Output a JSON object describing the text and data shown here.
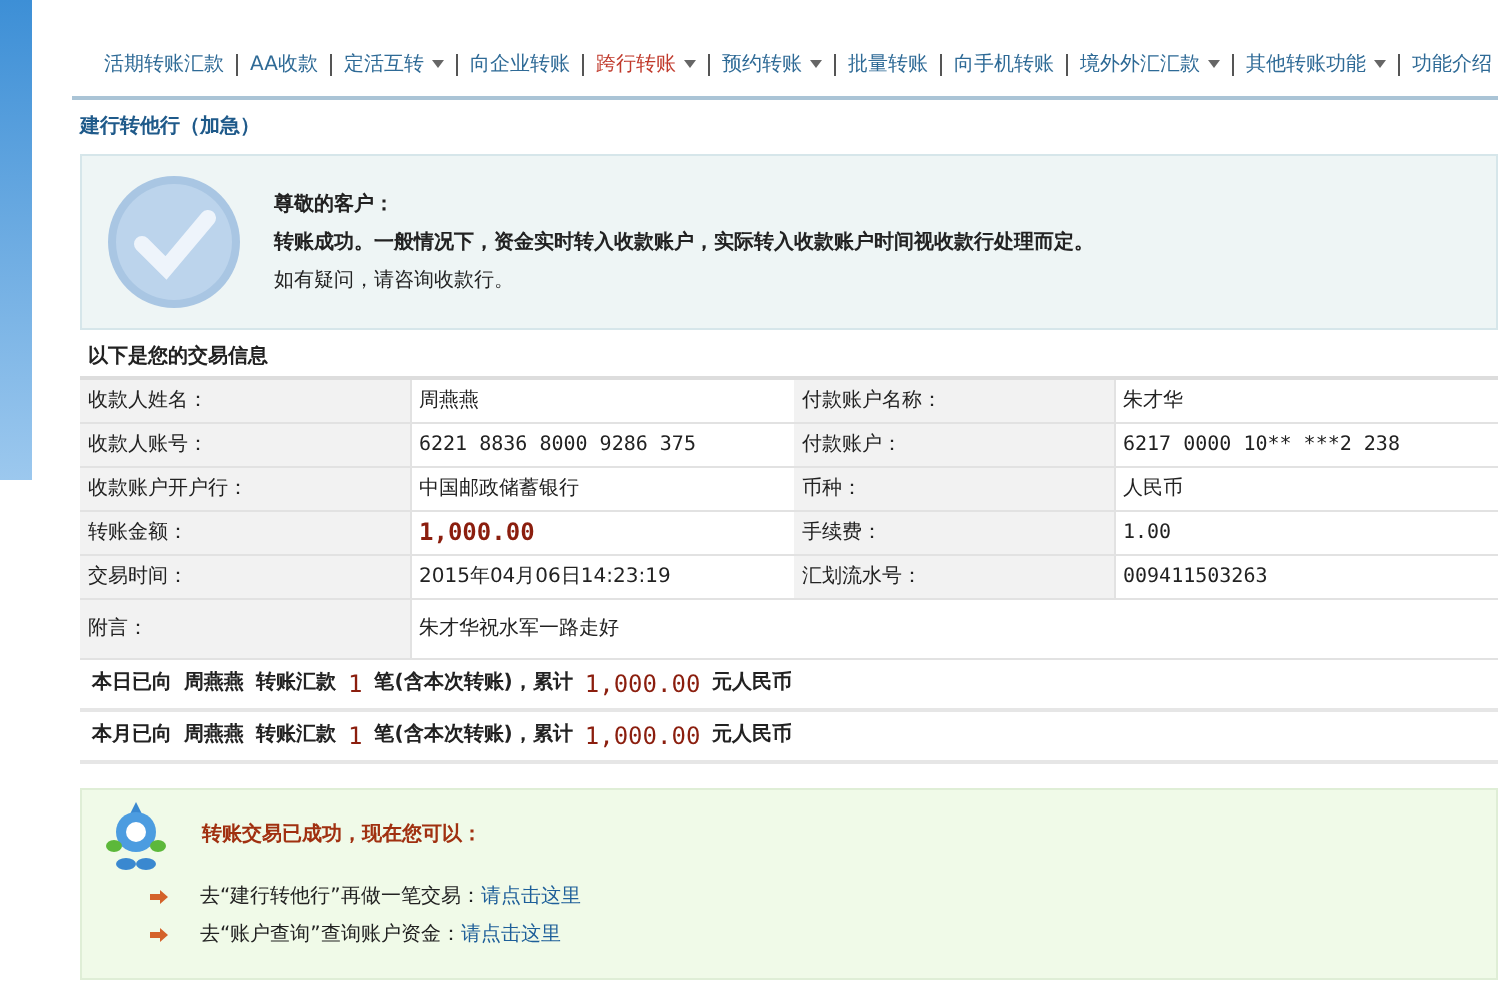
{
  "nav": [
    {
      "label": "活期转账汇款",
      "dropdown": false,
      "selected": false
    },
    {
      "label": "AA收款",
      "dropdown": false,
      "selected": false
    },
    {
      "label": "定活互转",
      "dropdown": true,
      "selected": false
    },
    {
      "label": "向企业转账",
      "dropdown": false,
      "selected": false
    },
    {
      "label": "跨行转账",
      "dropdown": true,
      "selected": true
    },
    {
      "label": "预约转账",
      "dropdown": true,
      "selected": false
    },
    {
      "label": "批量转账",
      "dropdown": false,
      "selected": false
    },
    {
      "label": "向手机转账",
      "dropdown": false,
      "selected": false
    },
    {
      "label": "境外外汇汇款",
      "dropdown": true,
      "selected": false
    },
    {
      "label": "其他转账功能",
      "dropdown": true,
      "selected": false
    },
    {
      "label": "功能介绍",
      "dropdown": false,
      "selected": false
    }
  ],
  "page_title": "建行转他行（加急）",
  "notice": {
    "greeting": "尊敬的客户：",
    "message": "转账成功。一般情况下，资金实时转入收款账户，实际转入收款账户时间视收款行处理而定。",
    "hint": "如有疑问，请咨询收款行。"
  },
  "table": {
    "title": "以下是您的交易信息",
    "rows": [
      {
        "cells": [
          {
            "label": "收款人姓名：",
            "value": "周燕燕"
          },
          {
            "label": "付款账户名称：",
            "value": "朱才华"
          }
        ]
      },
      {
        "cells": [
          {
            "label": "收款人账号：",
            "value": "6221 8836 8000 9286 375"
          },
          {
            "label": "付款账户：",
            "value": "6217 0000 10** ***2 238"
          }
        ]
      },
      {
        "cells": [
          {
            "label": "收款账户开户行：",
            "value": "中国邮政储蓄银行"
          },
          {
            "label": "币种：",
            "value": "人民币"
          }
        ]
      },
      {
        "cells": [
          {
            "label": "转账金额：",
            "value": "1,000.00",
            "kind": "amount"
          },
          {
            "label": "手续费：",
            "value": "1.00"
          }
        ]
      },
      {
        "cells": [
          {
            "label": "交易时间：",
            "value": "2015年04月06日14:23:19"
          },
          {
            "label": "汇划流水号：",
            "value": "009411503263"
          }
        ]
      },
      {
        "cells": [
          {
            "label": "附言：",
            "value": "朱才华祝水军一路走好"
          }
        ]
      }
    ]
  },
  "summaries": [
    {
      "parts": [
        {
          "text": "本日已向",
          "highlight": false
        },
        {
          "text": "周燕燕",
          "highlight": false
        },
        {
          "text": "转账汇款",
          "highlight": false
        },
        {
          "text": "1",
          "highlight": true
        },
        {
          "text": "笔(含本次转账)，累计",
          "highlight": false
        },
        {
          "text": "1,000.00",
          "highlight": true
        },
        {
          "text": "元人民币",
          "highlight": false
        }
      ]
    },
    {
      "parts": [
        {
          "text": "本月已向",
          "highlight": false
        },
        {
          "text": "周燕燕",
          "highlight": false
        },
        {
          "text": "转账汇款",
          "highlight": false
        },
        {
          "text": "1",
          "highlight": true
        },
        {
          "text": "笔(含本次转账)，累计",
          "highlight": false
        },
        {
          "text": "1,000.00",
          "highlight": true
        },
        {
          "text": "元人民币",
          "highlight": false
        }
      ]
    }
  ],
  "next_steps": {
    "title": "转账交易已成功，现在您可以：",
    "items": [
      {
        "text": "去“建行转他行”再做一笔交易：",
        "link": "请点击这里"
      },
      {
        "text": "去“账户查询”查询账户资金：",
        "link": "请点击这里"
      }
    ]
  }
}
